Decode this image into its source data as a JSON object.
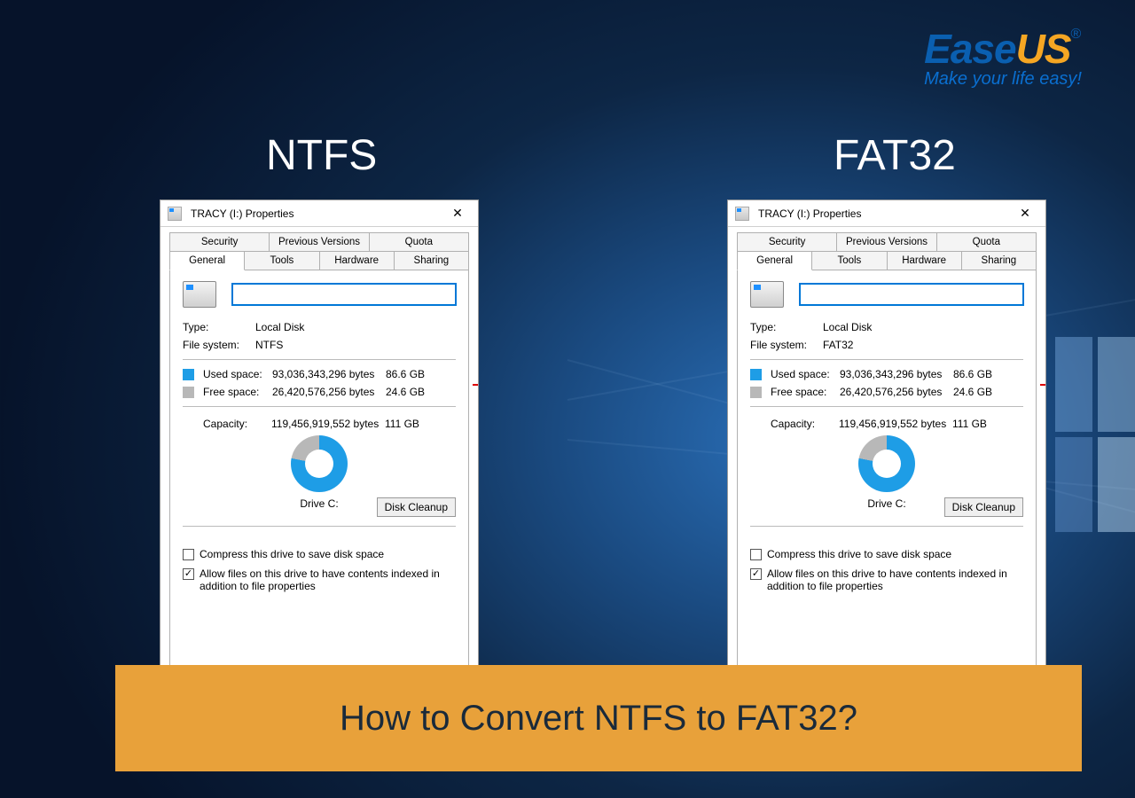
{
  "logo": {
    "ease": "Ease",
    "us": "US",
    "reg": "®",
    "tagline": "Make your life easy!"
  },
  "headings": {
    "left": "NTFS",
    "right": "FAT32"
  },
  "dialog": {
    "title": "TRACY (I:) Properties",
    "tabs_top": [
      "Security",
      "Previous Versions",
      "Quota"
    ],
    "tabs_bottom": [
      "General",
      "Tools",
      "Hardware",
      "Sharing"
    ],
    "type_label": "Type:",
    "type_value": "Local Disk",
    "fs_label": "File system:",
    "used_label": "Used space:",
    "used_bytes": "93,036,343,296 bytes",
    "used_hr": "86.6 GB",
    "free_label": "Free space:",
    "free_bytes": "26,420,576,256 bytes",
    "free_hr": "24.6 GB",
    "cap_label": "Capacity:",
    "cap_bytes": "119,456,919,552 bytes",
    "cap_hr": "111 GB",
    "drive_label": "Drive C:",
    "cleanup": "Disk Cleanup",
    "compress": "Compress this drive to save disk space",
    "index": "Allow files on this drive to have contents indexed in addition to file properties"
  },
  "left_fs": "NTFS",
  "right_fs": "FAT32",
  "banner": "How to Convert NTFS to FAT32?"
}
